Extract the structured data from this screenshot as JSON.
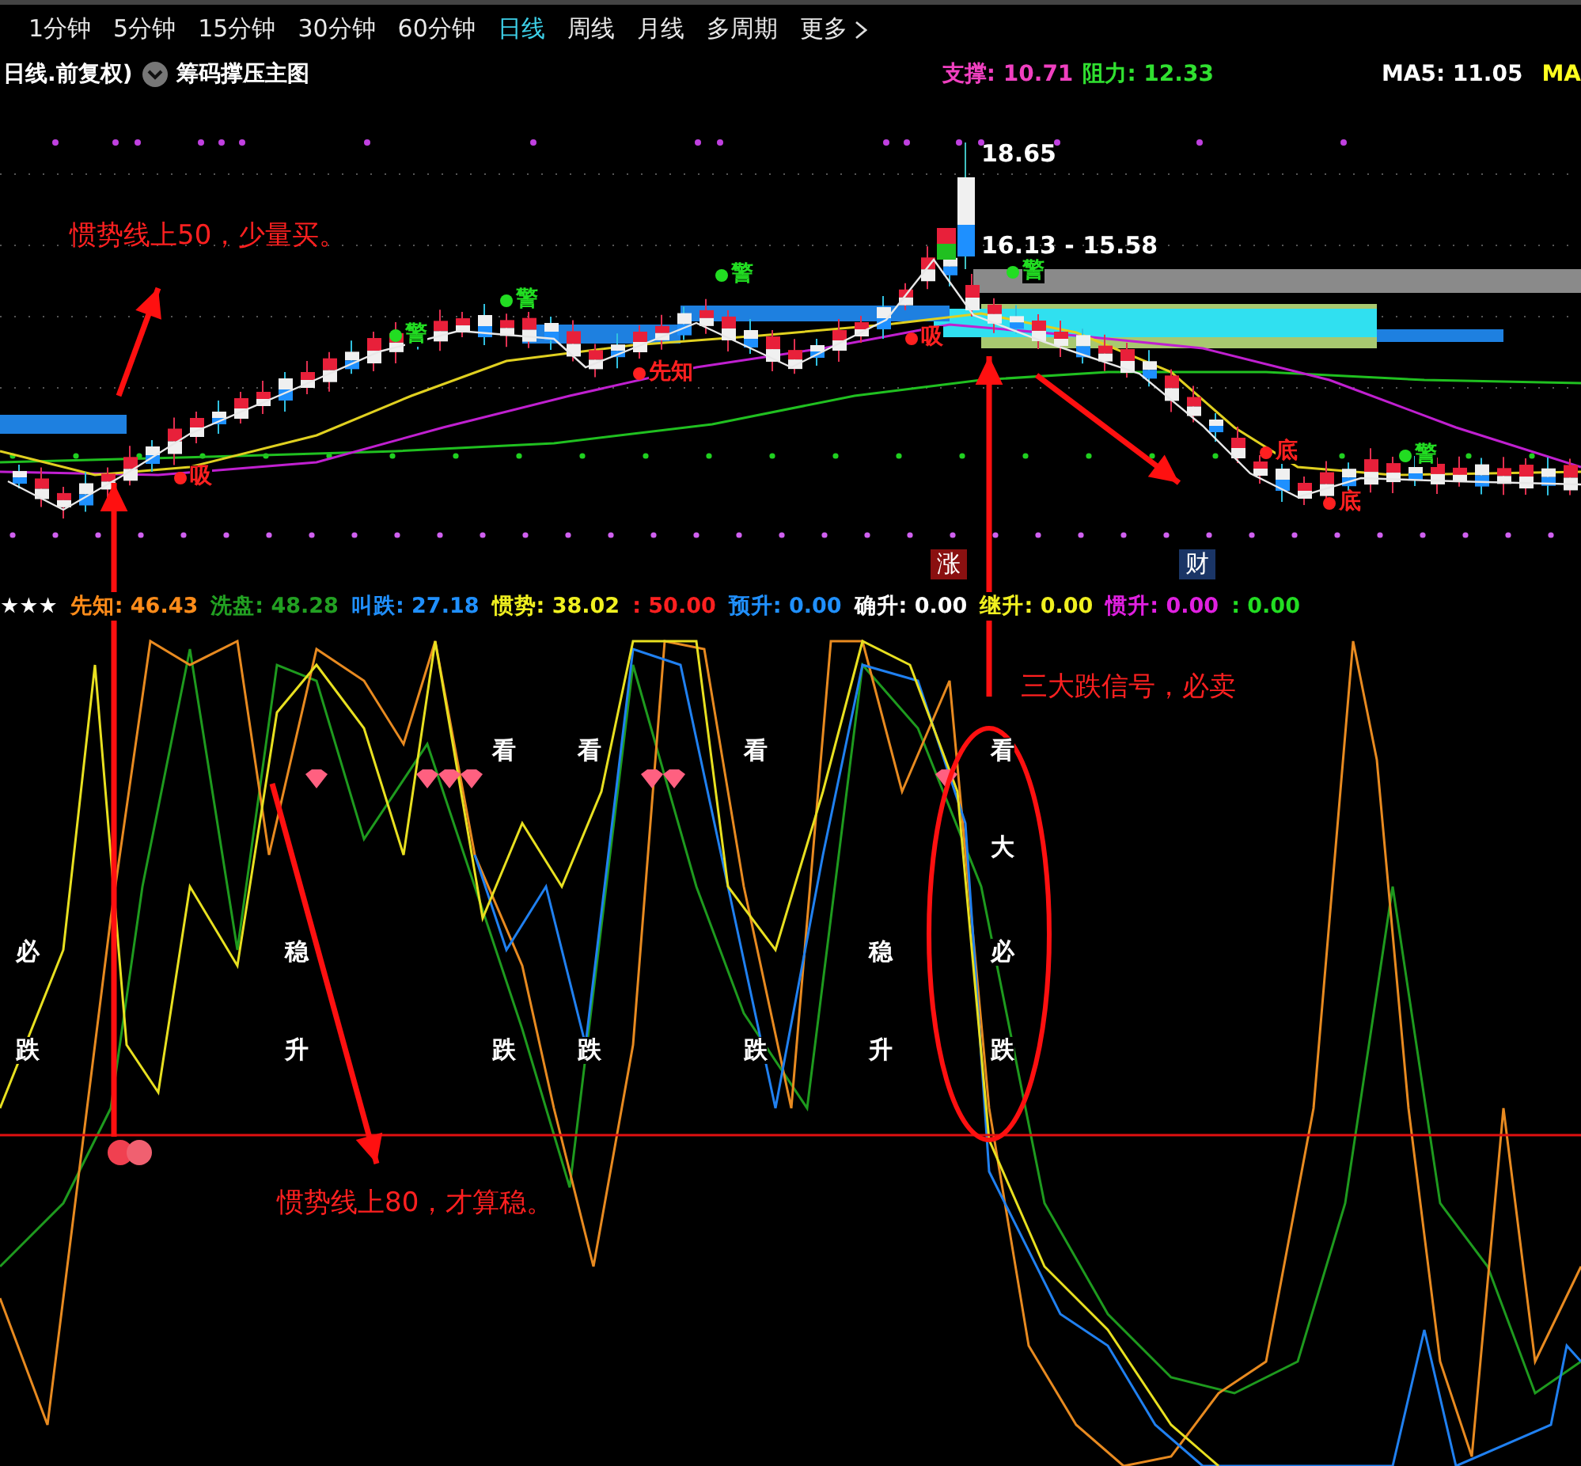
{
  "period_tabs": [
    {
      "label": "1分钟",
      "selected": false
    },
    {
      "label": "5分钟",
      "selected": false
    },
    {
      "label": "15分钟",
      "selected": false
    },
    {
      "label": "30分钟",
      "selected": false
    },
    {
      "label": "60分钟",
      "selected": false
    },
    {
      "label": "日线",
      "selected": true
    },
    {
      "label": "周线",
      "selected": false
    },
    {
      "label": "月线",
      "selected": false
    },
    {
      "label": "多周期",
      "selected": false
    },
    {
      "label": "更多",
      "selected": false
    }
  ],
  "info_bar": {
    "title": "日线.前复权)",
    "indicator_name": "筹码撑压主图",
    "readings": [
      {
        "text": "支撑: 10.71",
        "color": "#f040c0"
      },
      {
        "text": "阻力: 12.33",
        "color": "#30e030"
      },
      {
        "text": "MA5: 11.05",
        "color": "#ffffff"
      },
      {
        "text": "MA",
        "color": "#ffff20"
      }
    ]
  },
  "main_chart": {
    "price_labels": [
      "18.65",
      "16.13 - 15.58"
    ],
    "signals": [
      {
        "text": "警",
        "color": "#22dd22"
      },
      {
        "text": "警",
        "color": "#22dd22"
      },
      {
        "text": "警",
        "color": "#22dd22"
      },
      {
        "text": "警",
        "color": "#22dd22"
      },
      {
        "text": "警",
        "color": "#22dd22"
      },
      {
        "text": "吸",
        "color": "#ff2020"
      },
      {
        "text": "先知",
        "color": "#ff2020"
      },
      {
        "text": "吸",
        "color": "#ff2020"
      },
      {
        "text": "底",
        "color": "#ff2020"
      },
      {
        "text": "底",
        "color": "#ff2020"
      }
    ],
    "annotation": "惯势线上50，少量买。",
    "markers": [
      {
        "text": "涨",
        "color": "#8a1010"
      },
      {
        "text": "财",
        "color": "#1a3566"
      }
    ]
  },
  "indicator_panel": {
    "rating": "★★★",
    "legend": [
      {
        "text": "先知: 46.43",
        "color": "#ff8c1a"
      },
      {
        "text": "洗盘: 48.28",
        "color": "#22a022"
      },
      {
        "text": "叫跌: 27.18",
        "color": "#2090ff"
      },
      {
        "text": "惯势: 38.02",
        "color": "#f0f020"
      },
      {
        "text": ": 50.00",
        "color": "#ff2020"
      },
      {
        "text": "预升: 0.00",
        "color": "#2090ff"
      },
      {
        "text": "确升: 0.00",
        "color": "#ffffff"
      },
      {
        "text": "继升: 0.00",
        "color": "#f0f020"
      },
      {
        "text": "惯升: 0.00",
        "color": "#e020e0"
      },
      {
        "text": ": 0.00",
        "color": "#22dd22"
      }
    ],
    "signal_columns": [
      [
        null,
        null,
        "必",
        "跌"
      ],
      [
        null,
        null,
        "稳",
        "升"
      ],
      [
        "看",
        null,
        null,
        "跌"
      ],
      [
        "看",
        null,
        null,
        "跌"
      ],
      [
        "看",
        null,
        null,
        "跌"
      ],
      [
        null,
        null,
        "稳",
        "升"
      ],
      [
        "看",
        "大",
        "必",
        "跌"
      ]
    ],
    "annotations": [
      "三大跌信号，必卖",
      "惯势线上80，才算稳。"
    ]
  }
}
